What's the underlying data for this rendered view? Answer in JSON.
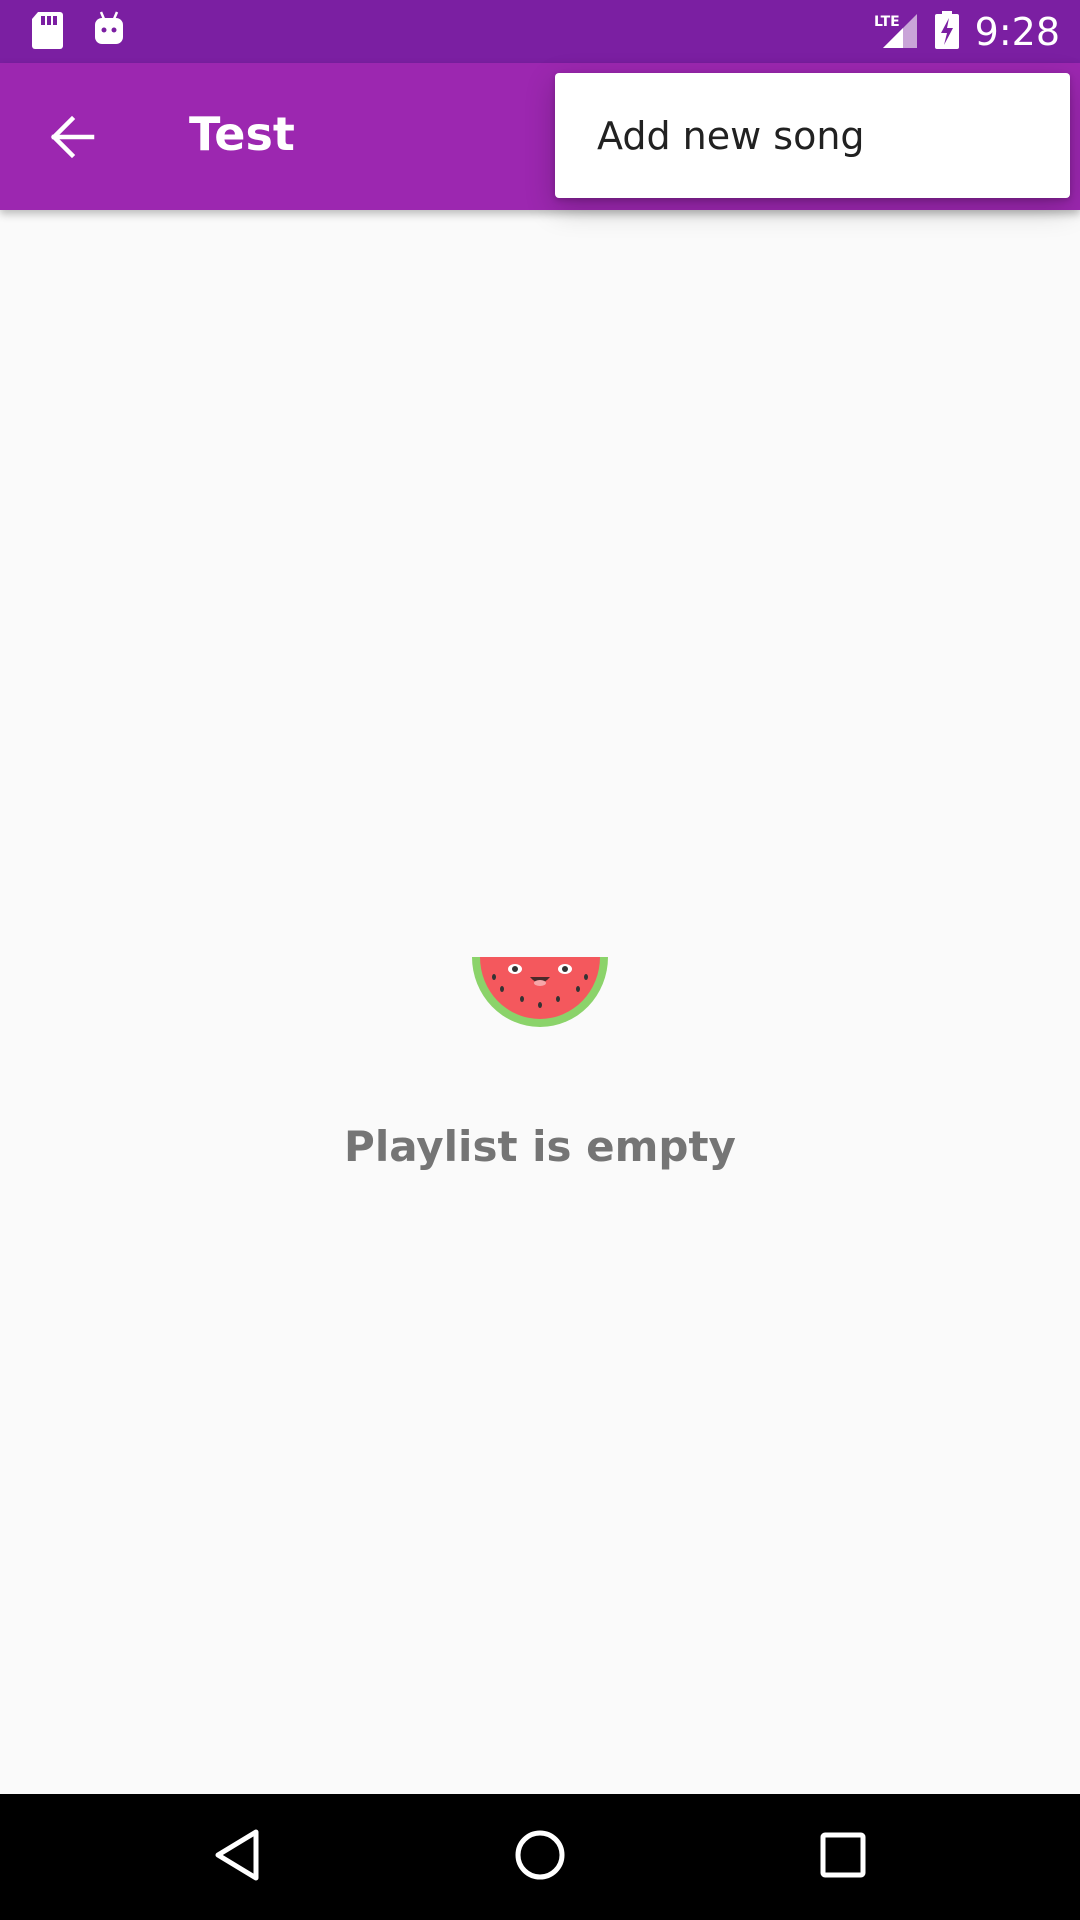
{
  "status_bar": {
    "time": "9:28",
    "network": "LTE",
    "icons": [
      "sd-card-icon",
      "android-icon",
      "lte-signal-icon",
      "battery-charging-icon"
    ]
  },
  "app_bar": {
    "title": "Test",
    "back_icon": "arrow-back-icon",
    "color": "#9c27b0"
  },
  "overflow_menu": {
    "items": [
      {
        "label": "Add new song"
      }
    ]
  },
  "empty_state": {
    "icon": "watermelon-icon",
    "message": "Playlist is empty"
  },
  "nav_bar": {
    "buttons": [
      "back-triangle-icon",
      "home-circle-icon",
      "recents-square-icon"
    ]
  },
  "colors": {
    "status_bar": "#7b1fa2",
    "app_bar": "#9c27b0",
    "background": "#fafafa",
    "empty_text": "#757575"
  }
}
